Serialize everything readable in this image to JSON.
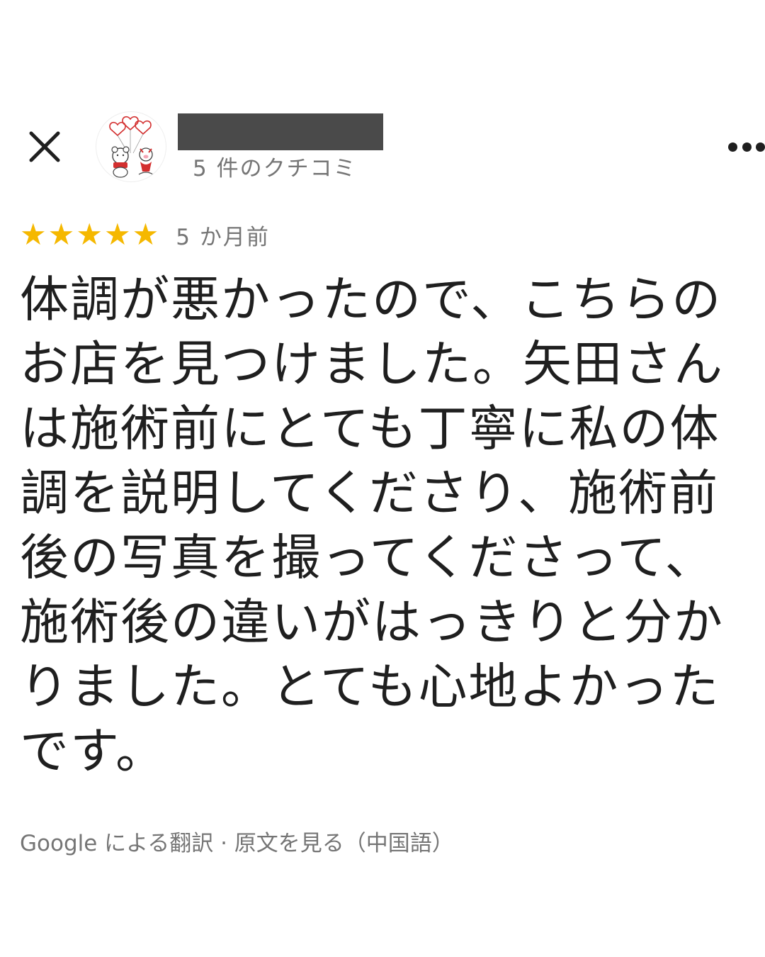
{
  "header": {
    "review_count": "5 件のクチコミ"
  },
  "review": {
    "stars": [
      "★",
      "★",
      "★",
      "★",
      "★"
    ],
    "rating": 5,
    "date": "5 か月前",
    "text": "体調が悪かったので、こちらのお店を見つけました。矢田さんは施術前にとても丁寧に私の体調を説明してくださり、施術前後の写真を撮ってくださって、施術後の違いがはっきりと分かりました。とても心地よかったです。"
  },
  "translation": {
    "label": "Google による翻訳 · ",
    "original_link": "原文を見る（中国語）"
  },
  "colors": {
    "star": "#f5b800",
    "meta_text": "#757575",
    "body_text": "#1f1f1f"
  },
  "icons": {
    "close": "close-icon",
    "more": "more-horizontal-icon"
  }
}
